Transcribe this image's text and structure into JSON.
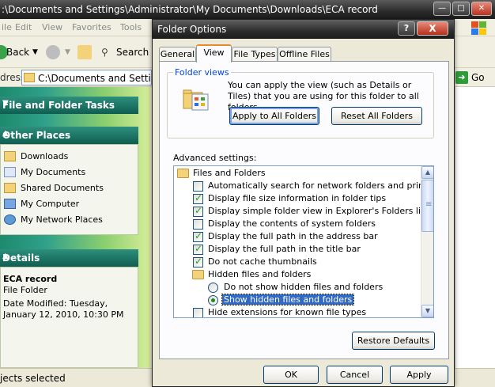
{
  "explorer": {
    "title": ":\\Documents and Settings\\Administrator\\My Documents\\Downloads\\ECA record",
    "menu": [
      "ile",
      "Edit",
      "View",
      "Favorites",
      "Tools"
    ],
    "toolbar": {
      "back": "Back",
      "search": "Search"
    },
    "address": {
      "label": "dress",
      "value": "C:\\Documents and Settings\\A",
      "go": "Go"
    },
    "tasks": {
      "file_folder_title": "File and Folder Tasks",
      "other_places_title": "Other Places",
      "places": [
        "Downloads",
        "My Documents",
        "Shared Documents",
        "My Computer",
        "My Network Places"
      ],
      "details_title": "Details",
      "details_name": "ECA record",
      "details_type": "File Folder",
      "details_modified_1": "Date Modified: Tuesday,",
      "details_modified_2": "January 12, 2010, 10:30 PM"
    },
    "status": "jects selected"
  },
  "dialog": {
    "title": "Folder Options",
    "help_glyph": "?",
    "close_glyph": "X",
    "tabs": [
      "General",
      "View",
      "File Types",
      "Offline Files"
    ],
    "active_tab": "View",
    "folder_views": {
      "legend": "Folder views",
      "description": "You can apply the view (such as Details or Tiles) that you are using for this folder to all folders.",
      "apply_button": "Apply to All Folders",
      "reset_button": "Reset All Folders"
    },
    "advanced_label": "Advanced settings:",
    "settings": [
      {
        "kind": "folder",
        "label": "Files and Folders",
        "level": 0
      },
      {
        "kind": "checkbox",
        "label": "Automatically search for network folders and printers",
        "checked": false,
        "level": 1
      },
      {
        "kind": "checkbox",
        "label": "Display file size information in folder tips",
        "checked": true,
        "level": 1
      },
      {
        "kind": "checkbox",
        "label": "Display simple folder view in Explorer's Folders list",
        "checked": true,
        "level": 1
      },
      {
        "kind": "checkbox",
        "label": "Display the contents of system folders",
        "checked": false,
        "level": 1
      },
      {
        "kind": "checkbox",
        "label": "Display the full path in the address bar",
        "checked": true,
        "level": 1
      },
      {
        "kind": "checkbox",
        "label": "Display the full path in the title bar",
        "checked": true,
        "level": 1
      },
      {
        "kind": "checkbox",
        "label": "Do not cache thumbnails",
        "checked": true,
        "level": 1
      },
      {
        "kind": "folder",
        "label": "Hidden files and folders",
        "level": 1
      },
      {
        "kind": "radio",
        "label": "Do not show hidden files and folders",
        "checked": false,
        "level": 2
      },
      {
        "kind": "radio",
        "label": "Show hidden files and folders",
        "checked": true,
        "selected": true,
        "level": 2
      },
      {
        "kind": "checkbox",
        "label": "Hide extensions for known file types",
        "checked": false,
        "level": 1
      }
    ],
    "restore_button": "Restore Defaults",
    "ok_button": "OK",
    "cancel_button": "Cancel",
    "apply_button": "Apply"
  },
  "colors": {
    "selection": "#316ac5",
    "legend_blue": "#0046d5",
    "check_green": "#21a121",
    "task_pane_green": "#1c8a6d"
  }
}
